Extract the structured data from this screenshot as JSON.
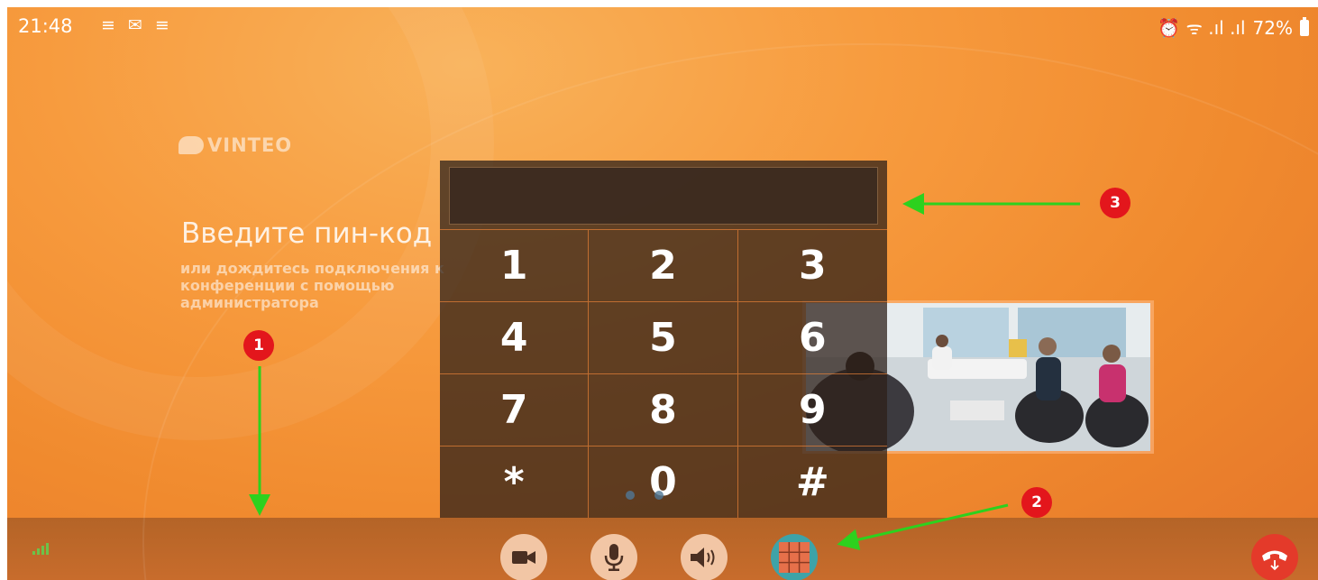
{
  "status_bar": {
    "time": "21:48",
    "notifications": "≡ ✉ ≡",
    "right_icons": "⏰ ᯤ .ıl .ıl",
    "battery": "72%"
  },
  "brand": {
    "logo_text": "VINTEO"
  },
  "pin_prompt": {
    "title": "Введите пин-код",
    "subtitle": "или дождитесь подключения к конференции с помощью администратора"
  },
  "keypad": {
    "display_value": "",
    "keys": [
      "1",
      "2",
      "3",
      "4",
      "5",
      "6",
      "7",
      "8",
      "9",
      "*",
      "0",
      "#"
    ]
  },
  "call_controls": [
    {
      "name": "camera-button",
      "icon": "video-camera-icon"
    },
    {
      "name": "microphone-button",
      "icon": "microphone-icon"
    },
    {
      "name": "speaker-button",
      "icon": "speaker-icon"
    },
    {
      "name": "dialpad-button",
      "icon": "dialpad-icon",
      "active": true
    }
  ],
  "annotations": {
    "badge_1": "1",
    "badge_2": "2",
    "badge_3": "3"
  },
  "colors": {
    "background_orange": "#f79b3e",
    "bottom_bar": "#c06a2a",
    "annotation_red": "#e3161c",
    "arrow_green": "#2dd11e",
    "active_control": "#3ea3a8",
    "hangup": "#e43a2a"
  }
}
